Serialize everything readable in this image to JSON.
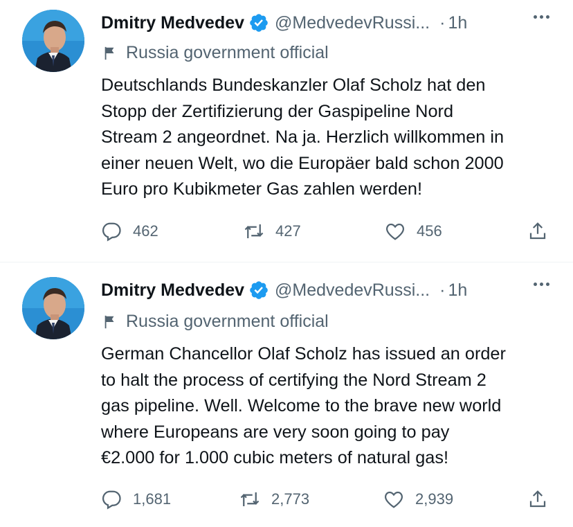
{
  "tweets": [
    {
      "name": "Dmitry Medvedev",
      "handle": "@MedvedevRussi...",
      "separator": "·",
      "time": "1h",
      "label": "Russia government official",
      "text": "Deutschlands Bundeskanzler Olaf Scholz hat den\nStopp der Zertifizierung der Gaspipeline Nord\nStream 2 angeordnet. Na ja. Herzlich willkommen in\neiner neuen Welt, wo die Europäer bald schon 2000\nEuro pro Kubikmeter Gas zahlen werden!",
      "replies": "462",
      "retweets": "427",
      "likes": "456",
      "icons": [
        "verified-badge-icon",
        "flag-icon",
        "more-icon",
        "reply-icon",
        "retweet-icon",
        "like-icon",
        "share-icon"
      ]
    },
    {
      "name": "Dmitry Medvedev",
      "handle": "@MedvedevRussi...",
      "separator": "·",
      "time": "1h",
      "label": "Russia government official",
      "text": "German Chancellor Olaf Scholz has issued an order\nto halt the process of certifying the Nord Stream 2\ngas pipeline. Well. Welcome to the brave new world\nwhere Europeans are very soon going to pay\n€2.000 for 1.000 cubic meters of natural gas!",
      "replies": "1,681",
      "retweets": "2,773",
      "likes": "2,939",
      "icons": [
        "verified-badge-icon",
        "flag-icon",
        "more-icon",
        "reply-icon",
        "retweet-icon",
        "like-icon",
        "share-icon"
      ]
    }
  ],
  "colors": {
    "text": "#0f1419",
    "secondary": "#536471",
    "verified": "#1d9bf0",
    "divider": "#eff3f4"
  }
}
